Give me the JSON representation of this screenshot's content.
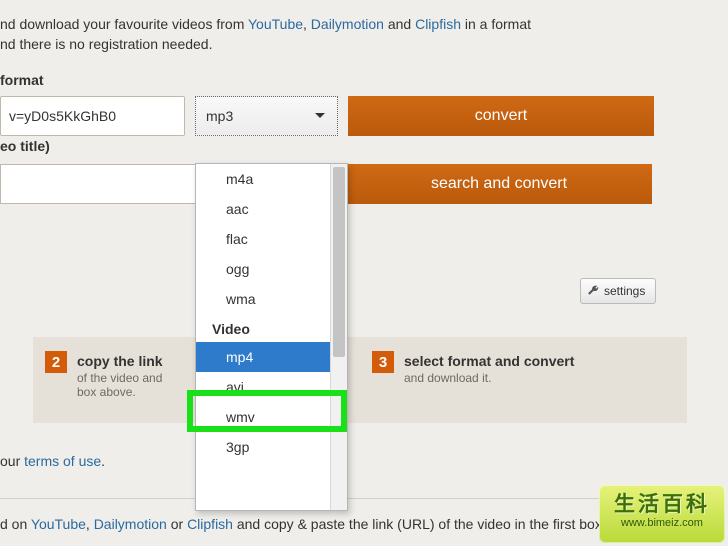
{
  "intro": {
    "line1_pre": "nd download your favourite videos from ",
    "link_yt": "YouTube",
    "sep1": ", ",
    "link_dm": "Dailymotion",
    "sep2": " and ",
    "link_cf": "Clipfish",
    "line1_post": " in a format",
    "line2": "nd there is no registration needed."
  },
  "format_label": "format",
  "url_value": "v=yD0s5KkGhB0",
  "selected_format": "mp3",
  "convert_label": "convert",
  "video_title_label": "eo title)",
  "search_convert_label": "search and convert",
  "settings_label": "settings",
  "dropdown": {
    "audio_items": [
      "m4a",
      "aac",
      "flac",
      "ogg",
      "wma"
    ],
    "group_video": "Video",
    "video_items": [
      "mp4",
      "avi",
      "wmv",
      "3gp"
    ],
    "selected": "mp4"
  },
  "step2": {
    "num": "2",
    "title": "copy the link",
    "desc_line1": "of the video and",
    "desc_line2": "box above."
  },
  "step3": {
    "num": "3",
    "title": "select format and convert",
    "desc": "and download it."
  },
  "terms": {
    "pre": "our ",
    "link": "terms of use",
    "post": "."
  },
  "footer": {
    "pre": "d on ",
    "yt": "YouTube",
    "sep1": ", ",
    "dm": "Dailymotion",
    "sep2": " or ",
    "cf": "Clipfish",
    "post": " and copy & paste the link (URL) of the video in the first box,"
  },
  "watermark": {
    "line1": "生活百科",
    "line2": "www.bimeiz.com"
  }
}
